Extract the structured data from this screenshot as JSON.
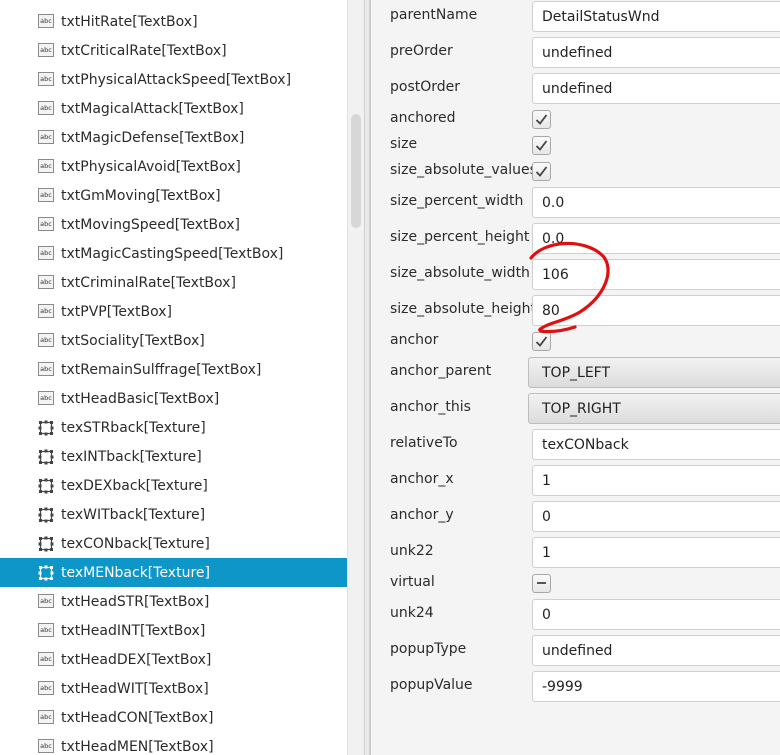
{
  "tree": {
    "items": [
      {
        "label": "txtHitRate[TextBox]",
        "icon": "textbox-icon"
      },
      {
        "label": "txtCriticalRate[TextBox]",
        "icon": "textbox-icon"
      },
      {
        "label": "txtPhysicalAttackSpeed[TextBox]",
        "icon": "textbox-icon"
      },
      {
        "label": "txtMagicalAttack[TextBox]",
        "icon": "textbox-icon"
      },
      {
        "label": "txtMagicDefense[TextBox]",
        "icon": "textbox-icon"
      },
      {
        "label": "txtPhysicalAvoid[TextBox]",
        "icon": "textbox-icon"
      },
      {
        "label": "txtGmMoving[TextBox]",
        "icon": "textbox-icon"
      },
      {
        "label": "txtMovingSpeed[TextBox]",
        "icon": "textbox-icon"
      },
      {
        "label": "txtMagicCastingSpeed[TextBox]",
        "icon": "textbox-icon"
      },
      {
        "label": "txtCriminalRate[TextBox]",
        "icon": "textbox-icon"
      },
      {
        "label": "txtPVP[TextBox]",
        "icon": "textbox-icon"
      },
      {
        "label": "txtSociality[TextBox]",
        "icon": "textbox-icon"
      },
      {
        "label": "txtRemainSulffrage[TextBox]",
        "icon": "textbox-icon"
      },
      {
        "label": "txtHeadBasic[TextBox]",
        "icon": "textbox-icon"
      },
      {
        "label": "texSTRback[Texture]",
        "icon": "texture-icon"
      },
      {
        "label": "texINTback[Texture]",
        "icon": "texture-icon"
      },
      {
        "label": "texDEXback[Texture]",
        "icon": "texture-icon"
      },
      {
        "label": "texWITback[Texture]",
        "icon": "texture-icon"
      },
      {
        "label": "texCONback[Texture]",
        "icon": "texture-icon"
      },
      {
        "label": "texMENback[Texture]",
        "icon": "texture-icon",
        "selected": true
      },
      {
        "label": "txtHeadSTR[TextBox]",
        "icon": "textbox-icon"
      },
      {
        "label": "txtHeadINT[TextBox]",
        "icon": "textbox-icon"
      },
      {
        "label": "txtHeadDEX[TextBox]",
        "icon": "textbox-icon"
      },
      {
        "label": "txtHeadWIT[TextBox]",
        "icon": "textbox-icon"
      },
      {
        "label": "txtHeadCON[TextBox]",
        "icon": "textbox-icon"
      },
      {
        "label": "txtHeadMEN[TextBox]",
        "icon": "textbox-icon"
      }
    ],
    "textbox_icon_text": "abc"
  },
  "props": {
    "rows": [
      {
        "label": "parentName",
        "type": "text",
        "value": "DetailStatusWnd"
      },
      {
        "label": "preOrder",
        "type": "text",
        "value": "undefined"
      },
      {
        "label": "postOrder",
        "type": "text",
        "value": "undefined"
      },
      {
        "label": "anchored",
        "type": "check",
        "checked": true
      },
      {
        "label": "size",
        "type": "check",
        "checked": true
      },
      {
        "label": "size_absolute_values",
        "type": "check",
        "checked": true
      },
      {
        "label": "size_percent_width",
        "type": "text",
        "value": "0.0"
      },
      {
        "label": "size_percent_height",
        "type": "text",
        "value": "0.0"
      },
      {
        "label": "size_absolute_width",
        "type": "text",
        "value": "106"
      },
      {
        "label": "size_absolute_height",
        "type": "text",
        "value": "80"
      },
      {
        "label": "anchor",
        "type": "check",
        "checked": true
      },
      {
        "label": "anchor_parent",
        "type": "combo",
        "value": "TOP_LEFT"
      },
      {
        "label": "anchor_this",
        "type": "combo",
        "value": "TOP_RIGHT"
      },
      {
        "label": "relativeTo",
        "type": "text",
        "value": "texCONback"
      },
      {
        "label": "anchor_x",
        "type": "text",
        "value": "1"
      },
      {
        "label": "anchor_y",
        "type": "text",
        "value": "0"
      },
      {
        "label": "unk22",
        "type": "text",
        "value": "1"
      },
      {
        "label": "virtual",
        "type": "check",
        "checked": "indeterminate"
      },
      {
        "label": "unk24",
        "type": "text",
        "value": "0"
      },
      {
        "label": "popupType",
        "type": "text",
        "value": "undefined"
      },
      {
        "label": "popupValue",
        "type": "text",
        "value": "-9999"
      }
    ]
  },
  "colors": {
    "selection": "#0f96c9",
    "annotation": "#e01010",
    "panel_bg": "#f4f4f4"
  }
}
